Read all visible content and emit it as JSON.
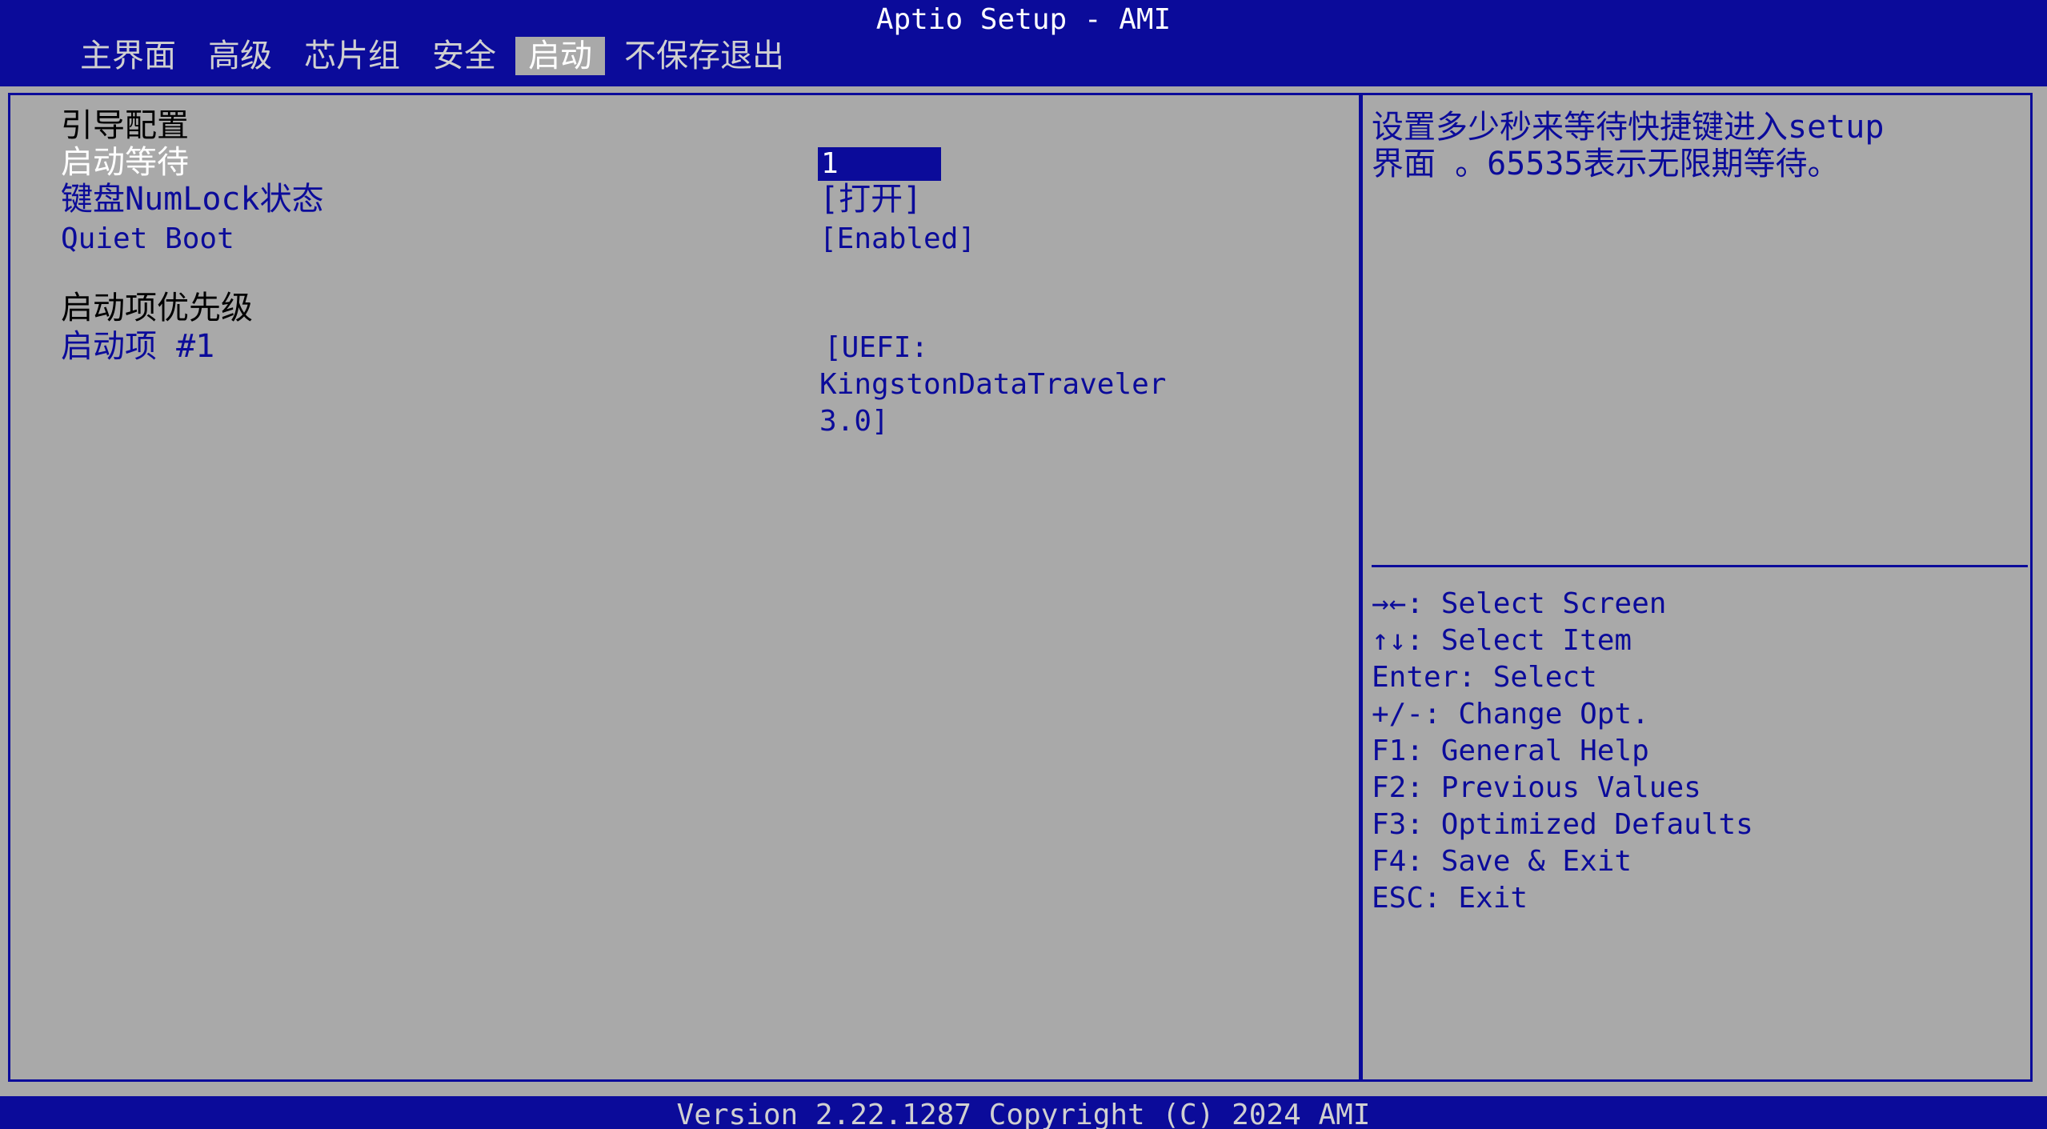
{
  "header": {
    "title": "Aptio Setup - AMI",
    "tabs": [
      {
        "label": "主界面"
      },
      {
        "label": "高级"
      },
      {
        "label": "芯片组"
      },
      {
        "label": "安全"
      },
      {
        "label": "启动"
      },
      {
        "label": "不保存退出"
      }
    ],
    "active_tab": "启动"
  },
  "main": {
    "section_boot_config": "引导配置",
    "boot_wait_label": "启动等待",
    "boot_wait_value": "1",
    "numlock_label": "键盘NumLock状态",
    "numlock_value": "[打开]",
    "quiet_boot_label": "Quiet Boot",
    "quiet_boot_value": "[Enabled]",
    "section_priority": "启动项优先级",
    "boot_option1_label": "启动项 #1",
    "boot_option1_value_line1": "[UEFI:",
    "boot_option1_value_line2": "KingstonDataTraveler",
    "boot_option1_value_line3": "3.0]"
  },
  "help": {
    "line1": "设置多少秒来等待快捷键进入setup",
    "line2": "界面 。65535表示无限期等待。"
  },
  "keys": [
    "→←: Select Screen",
    "↑↓: Select Item",
    "Enter: Select",
    "+/-: Change Opt.",
    "F1: General Help",
    "F2: Previous Values",
    "F3: Optimized Defaults",
    "F4: Save & Exit",
    "ESC: Exit"
  ],
  "footer": {
    "text": "Version 2.22.1287 Copyright (C) 2024 AMI"
  },
  "colors": {
    "bios_blue": "#0b0b9a",
    "panel_gray": "#a9a9a9"
  }
}
